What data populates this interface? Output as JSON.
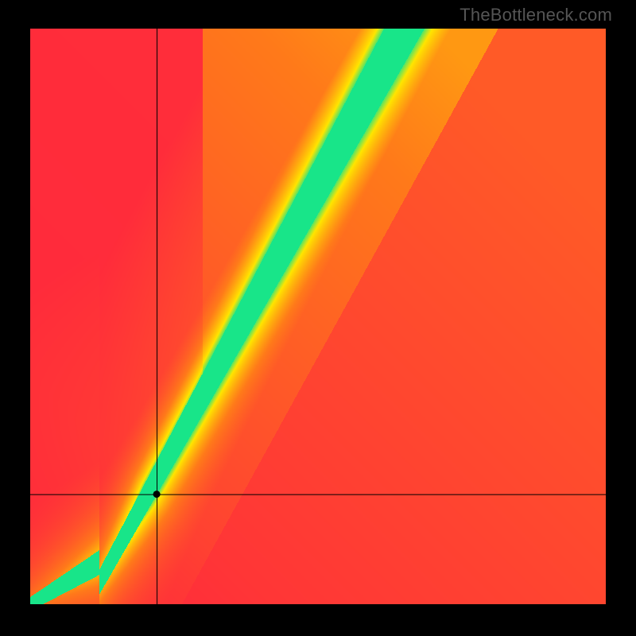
{
  "watermark": "TheBottleneck.com",
  "chart_data": {
    "type": "heatmap",
    "title": "",
    "xlabel": "",
    "ylabel": "",
    "xlim": [
      0,
      100
    ],
    "ylim": [
      0,
      100
    ],
    "crosshair": {
      "x": 22,
      "y": 19
    },
    "marker": {
      "x": 22,
      "y": 19
    },
    "ridge": {
      "description": "Green optimal band; slope ≈1.8, y ≈ -8 + 1.8·x near origin, band widens with x",
      "points": [
        {
          "x": 0,
          "y": 0
        },
        {
          "x": 10,
          "y": 7
        },
        {
          "x": 20,
          "y": 18
        },
        {
          "x": 30,
          "y": 34
        },
        {
          "x": 40,
          "y": 52
        },
        {
          "x": 50,
          "y": 70
        },
        {
          "x": 60,
          "y": 90
        },
        {
          "x": 65,
          "y": 100
        }
      ]
    },
    "colors": {
      "red": "#ff2a3c",
      "orange": "#ff7a1a",
      "yellow": "#ffe500",
      "green": "#18e58a",
      "cyan": "#20e0a0"
    },
    "grid": false,
    "legend": null
  }
}
